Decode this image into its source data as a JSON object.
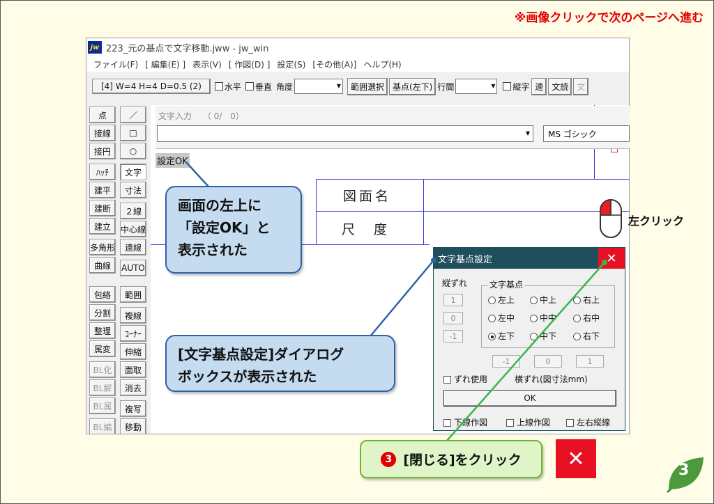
{
  "top_note": "※画像クリックで次のページへ進む",
  "window": {
    "logo": "jw",
    "title": "223_元の基点で文字移動.jww - jw_win",
    "menu": [
      "ファイル(F)",
      "[ 編集(E) ]",
      "表示(V)",
      "[ 作図(D) ]",
      "設定(S)",
      "[その他(A)]",
      "ヘルプ(H)"
    ]
  },
  "toolbar": {
    "layer_info": "[4] W=4 H=4 D=0.5 (2)",
    "horizontal": "水平",
    "vertical": "垂直",
    "angle": "角度",
    "range_select": "範囲選択",
    "base_point": "基点(左下)",
    "line_spacing": "行間",
    "vertical_text": "縦字",
    "continuous": "連",
    "read_text": "文読",
    "extra": "文"
  },
  "left_tools": {
    "col1": [
      "点",
      "接線",
      "接円",
      "ﾊｯﾁ",
      "建平",
      "建断",
      "建立",
      "多角形",
      "曲線",
      "包絡",
      "分割",
      "整理",
      "属変",
      "BL化",
      "BL解",
      "BL属",
      "BL編"
    ],
    "col2": [
      "／",
      "□",
      "○",
      "文字",
      "寸法",
      "２線",
      "中心線",
      "連線",
      "AUTO",
      "範囲",
      "複線",
      "ｺｰﾅｰ",
      "伸縮",
      "面取",
      "消去",
      "複写",
      "移動"
    ]
  },
  "textbar": {
    "label": "文字入力　 （ 0/　0）",
    "font": "MS ゴシック"
  },
  "status_text": "設定OK",
  "drawing": {
    "cell1": "図面名",
    "cell2": "尺　度"
  },
  "dialog": {
    "title": "文字基点設定",
    "offset_label": "縦ずれ",
    "group_label": "文字基点",
    "offset_values": [
      "1",
      "0",
      "-1"
    ],
    "radios": [
      [
        "左上",
        "中上",
        "右上"
      ],
      [
        "左中",
        "中中",
        "右中"
      ],
      [
        "左下",
        "中下",
        "右下"
      ]
    ],
    "h_values": [
      "-1",
      "0",
      "1"
    ],
    "use_offset": "ずれ使用",
    "h_offset_label": "横ずれ(図寸法mm)",
    "ok": "OK",
    "under_line": "下線作図",
    "over_line": "上線作図",
    "side_line": "左右縦線"
  },
  "callouts": {
    "status_line1": "画面の左上に",
    "status_line2": "「設定OK」と",
    "status_line3": "表示された",
    "dialog_line1": "[文字基点設定]ダイアログ",
    "dialog_line2": "ボックスが表示された"
  },
  "mouse_label": "左クリック",
  "action": {
    "number": "3",
    "text": "[閉じる]をクリック"
  },
  "close_symbol": "✕",
  "page_number": "3"
}
